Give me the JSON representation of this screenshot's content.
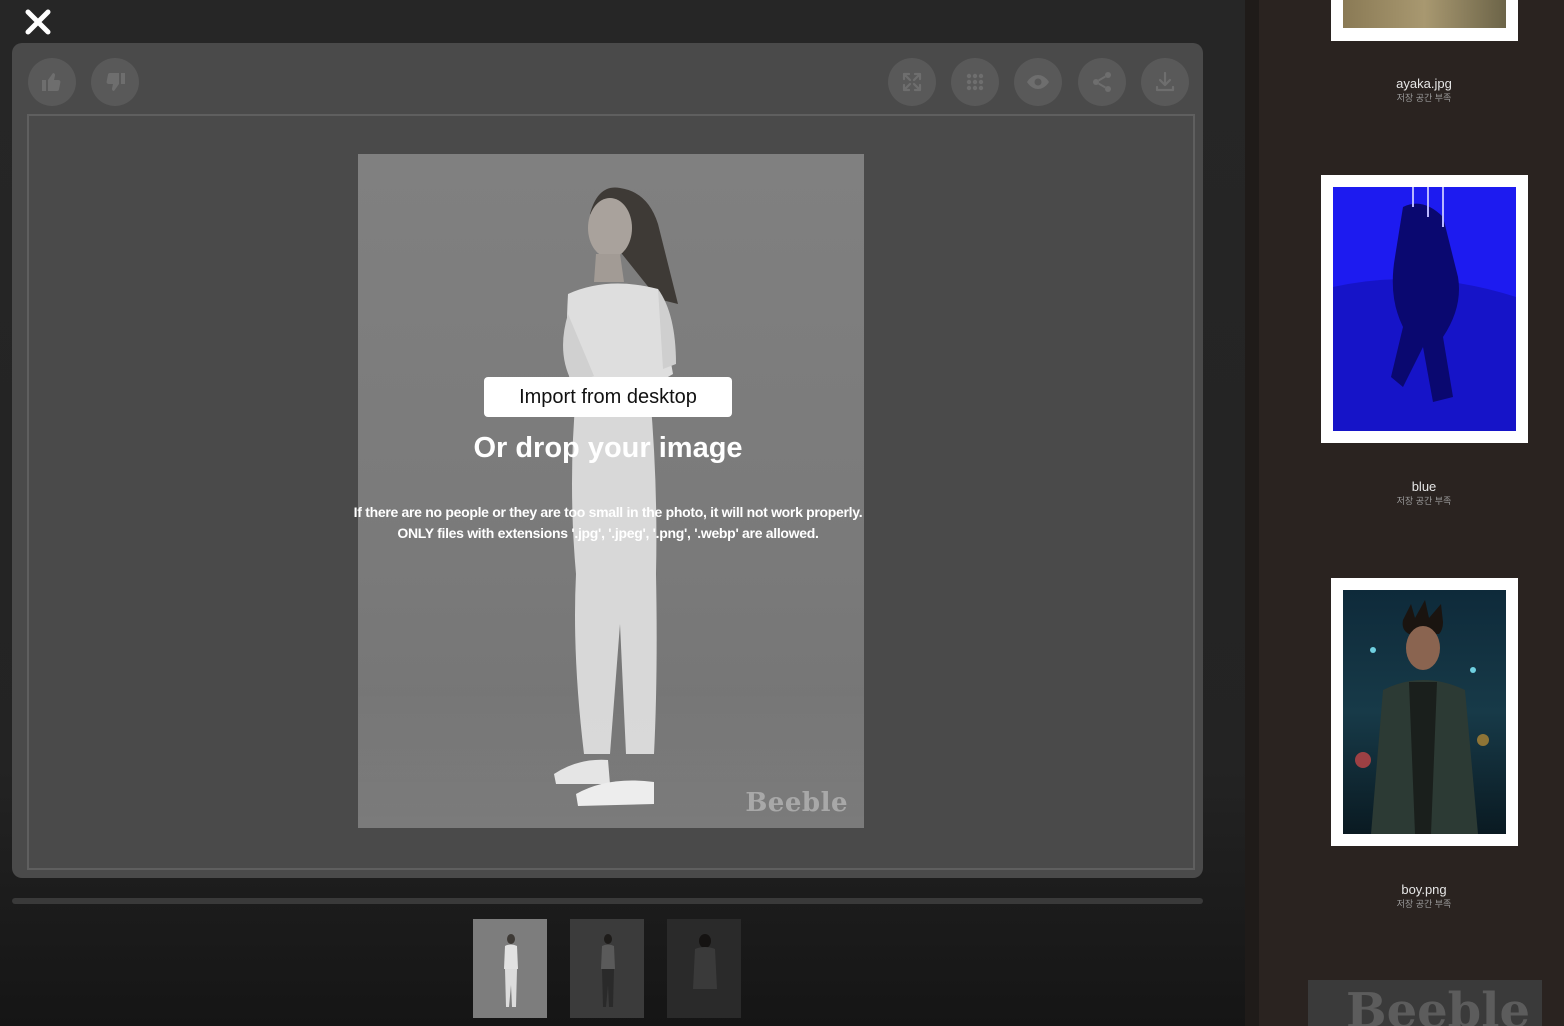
{
  "colors": {
    "modal_bg": "#262626",
    "panel_bg": "#4a4a4a",
    "sidebar_bg": "#2a2320"
  },
  "toolbar": {
    "left": [
      {
        "name": "thumbs-up-icon"
      },
      {
        "name": "thumbs-down-icon"
      }
    ],
    "right": [
      {
        "name": "fullscreen-icon"
      },
      {
        "name": "grid-icon"
      },
      {
        "name": "eye-icon"
      },
      {
        "name": "share-icon"
      },
      {
        "name": "download-icon"
      }
    ]
  },
  "canvas": {
    "import_label": "Import from desktop",
    "drop_title": "Or drop your image",
    "notice_line1": "If there are no people or they are too small in the photo, it will not work properly.",
    "notice_line2": "ONLY files with extensions '.jpg', '.jpeg', '.png', '.webp' are allowed.",
    "watermark": "Beeble"
  },
  "thumbnails": [
    {
      "selected": true
    },
    {
      "selected": false
    },
    {
      "selected": false
    }
  ],
  "gallery": [
    {
      "name": "ayaka.jpg",
      "sub": "저장 공간 부족"
    },
    {
      "name": "blue",
      "sub": "저장 공간 부족"
    },
    {
      "name": "boy.png",
      "sub": "저장 공간 부족"
    }
  ],
  "brand_logo": "Beeble"
}
